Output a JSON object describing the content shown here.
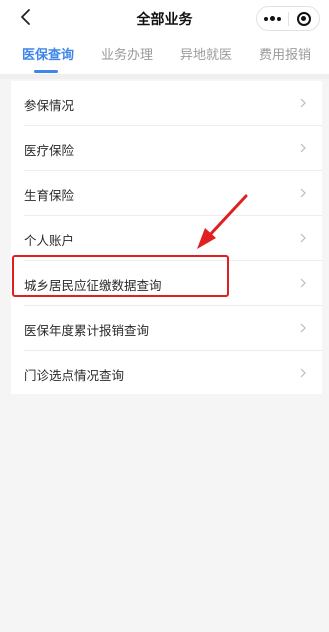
{
  "header": {
    "title": "全部业务",
    "back_icon": "back-arrow-icon",
    "more_icon": "more-dots-icon",
    "close_icon": "target-close-icon"
  },
  "tabs": [
    {
      "label": "医保查询",
      "active": true
    },
    {
      "label": "业务办理",
      "active": false
    },
    {
      "label": "异地就医",
      "active": false
    },
    {
      "label": "费用报销",
      "active": false
    }
  ],
  "list": {
    "items": [
      {
        "label": "参保情况"
      },
      {
        "label": "医疗保险"
      },
      {
        "label": "生育保险"
      },
      {
        "label": "个人账户"
      },
      {
        "label": "城乡居民应征缴数据查询"
      },
      {
        "label": "医保年度累计报销查询"
      },
      {
        "label": "门诊选点情况查询"
      }
    ]
  },
  "annotation": {
    "highlight_color": "#e02020",
    "accent_color": "#3f86ea"
  }
}
